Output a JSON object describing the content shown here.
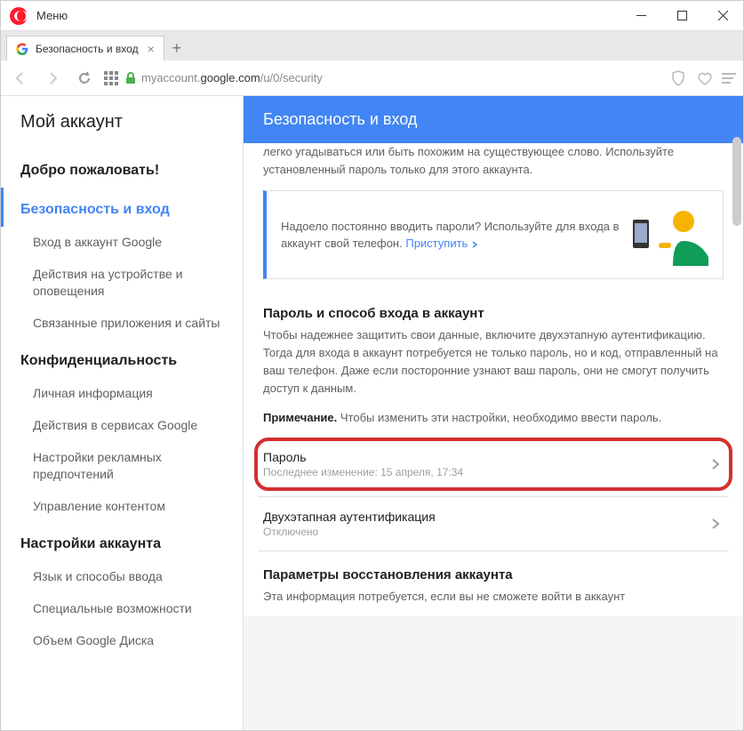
{
  "titlebar": {
    "menu": "Меню"
  },
  "tab": {
    "title": "Безопасность и вход"
  },
  "url": {
    "prefix": "myaccount.",
    "host": "google.com",
    "path": "/u/0/security"
  },
  "sidebar": {
    "title": "Мой аккаунт",
    "welcome": "Добро пожаловать!",
    "security": "Безопасность и вход",
    "security_items": {
      "signin": "Вход в аккаунт Google",
      "devices": "Действия на устройстве и оповещения",
      "apps": "Связанные приложения и сайты"
    },
    "privacy": "Конфиденциальность",
    "privacy_items": {
      "personal": "Личная информация",
      "activity": "Действия в сервисах Google",
      "ads": "Настройки рекламных предпочтений",
      "content": "Управление контентом"
    },
    "settings": "Настройки аккаунта",
    "settings_items": {
      "lang": "Язык и способы ввода",
      "access": "Специальные возможности",
      "storage": "Объем Google Диска"
    }
  },
  "main": {
    "header": "Безопасность и вход",
    "intro_cut": "легко угадываться или быть похожим на существующее слово. Используйте установленный пароль только для этого аккаунта.",
    "promo_text": "Надоело постоянно вводить пароли? Используйте для входа в аккаунт свой телефон. ",
    "promo_link": "Приступить",
    "pw_heading": "Пароль и способ входа в аккаунт",
    "pw_desc": "Чтобы надежнее защитить свои данные, включите двухэтапную аутентификацию. Тогда для входа в аккаунт потребуется не только пароль, но и код, отправленный на ваш телефон. Даже если посторонние узнают ваш пароль, они не смогут получить доступ к данным.",
    "note_label": "Примечание.",
    "note_text": " Чтобы изменить эти настройки, необходимо ввести пароль.",
    "password_row": {
      "title": "Пароль",
      "sub": "Последнее изменение: 15 апреля, 17:34"
    },
    "twostep_row": {
      "title": "Двухэтапная аутентификация",
      "sub": "Отключено"
    },
    "recovery_heading": "Параметры восстановления аккаунта",
    "recovery_desc": "Эта информация потребуется, если вы не сможете войти в аккаунт"
  }
}
